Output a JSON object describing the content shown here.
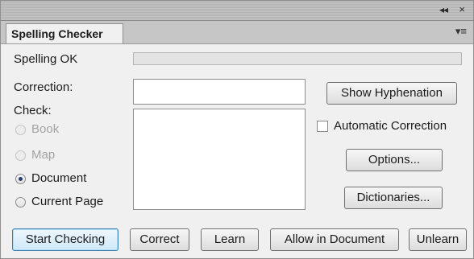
{
  "titlebar": {
    "collapse_glyph": "◂◂",
    "close_glyph": "×"
  },
  "tab": {
    "label": "Spelling Checker",
    "menu_glyph": "▾≡"
  },
  "status": {
    "text": "Spelling OK"
  },
  "correction": {
    "label": "Correction:",
    "value": ""
  },
  "check": {
    "label": "Check:",
    "options": [
      {
        "label": "Book",
        "enabled": false,
        "selected": false
      },
      {
        "label": "Map",
        "enabled": false,
        "selected": false
      },
      {
        "label": "Document",
        "enabled": true,
        "selected": true
      },
      {
        "label": "Current Page",
        "enabled": true,
        "selected": false
      }
    ]
  },
  "buttons": {
    "show_hyphenation": "Show Hyphenation",
    "automatic_correction": "Automatic Correction",
    "options": "Options...",
    "dictionaries": "Dictionaries...",
    "start_checking": "Start Checking",
    "correct": "Correct",
    "learn": "Learn",
    "allow_in_document": "Allow in Document",
    "unlearn": "Unlearn"
  }
}
